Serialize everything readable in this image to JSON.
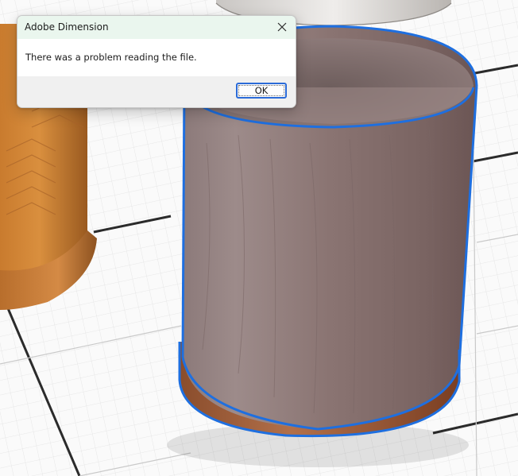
{
  "dialog": {
    "title": "Adobe Dimension",
    "message": "There was a problem reading the file.",
    "ok_label": "OK",
    "close_icon": "close-icon"
  },
  "scene": {
    "selection_color": "#1e6fe0",
    "objects": [
      "cup-left-wood",
      "cup-right-walnut-selected",
      "lid-top"
    ]
  }
}
